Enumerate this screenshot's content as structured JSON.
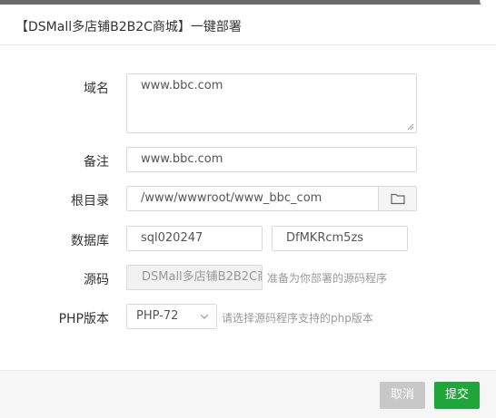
{
  "dialog": {
    "title": "【DSMall多店铺B2B2C商城】一键部署"
  },
  "form": {
    "domain": {
      "label": "域名",
      "value": "www.bbc.com"
    },
    "remark": {
      "label": "备注",
      "value": "www.bbc.com"
    },
    "root_dir": {
      "label": "根目录",
      "value": "/www/wwwroot/www_bbc_com"
    },
    "database": {
      "label": "数据库",
      "name": "sql020247",
      "password": "DfMKRcm5zs"
    },
    "source": {
      "label": "源码",
      "value": "DSMall多店铺B2B2C商",
      "hint": "准备为你部署的源码程序"
    },
    "php": {
      "label": "PHP版本",
      "selected": "PHP-72",
      "hint": "请选择源码程序支持的php版本"
    }
  },
  "footer": {
    "cancel_label": "取消",
    "submit_label": "提交"
  },
  "colors": {
    "primary": "#20a53a",
    "cancel": "#c8c8c8",
    "topbar": "#6b6b6b"
  },
  "icons": {
    "folder": "folder-icon",
    "chevron": "chevron-down-icon",
    "close": "close-icon"
  }
}
